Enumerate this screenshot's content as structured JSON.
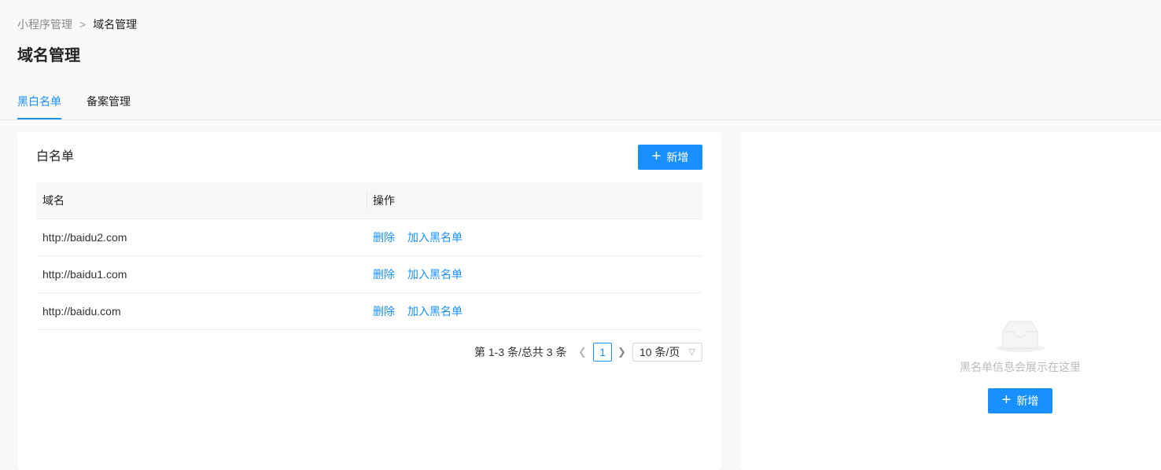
{
  "breadcrumb": {
    "parent": "小程序管理",
    "separator": ">",
    "current": "域名管理"
  },
  "page_title": "域名管理",
  "tabs": [
    {
      "label": "黑白名单",
      "active": true
    },
    {
      "label": "备案管理",
      "active": false
    }
  ],
  "whitelist": {
    "title": "白名单",
    "add_label": "新增",
    "columns": [
      "域名",
      "操作"
    ],
    "rows": [
      {
        "domain": "http://baidu2.com",
        "delete": "删除",
        "blacklist": "加入黑名单"
      },
      {
        "domain": "http://baidu1.com",
        "delete": "删除",
        "blacklist": "加入黑名单"
      },
      {
        "domain": "http://baidu.com",
        "delete": "删除",
        "blacklist": "加入黑名单"
      }
    ],
    "pagination": {
      "total_text": "第 1-3 条/总共 3 条",
      "current_page": "1",
      "prev_icon": "chevron-left-icon",
      "next_icon": "chevron-right-icon",
      "page_size": "10 条/页"
    }
  },
  "blacklist": {
    "empty_text": "黑名单信息会展示在这里",
    "add_label": "新增",
    "empty_icon": "inbox-icon"
  },
  "colors": {
    "primary": "#1890ff",
    "background": "#f9f9f9"
  }
}
